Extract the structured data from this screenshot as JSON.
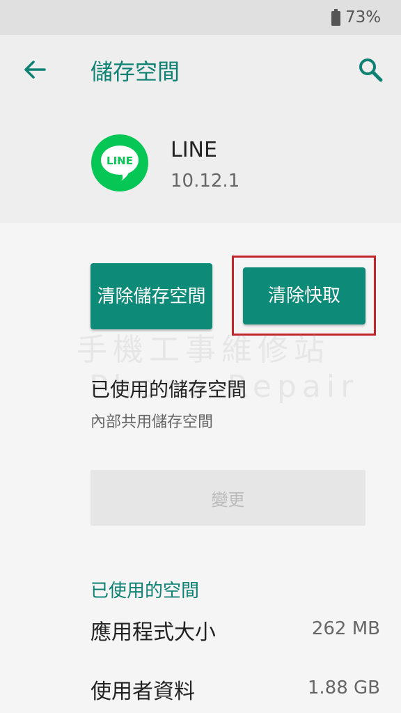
{
  "status_bar": {
    "battery_percent": "73%",
    "battery_icon": "battery-icon"
  },
  "header": {
    "title": "儲存空間",
    "back_icon": "arrow-back-icon",
    "search_icon": "search-icon"
  },
  "app": {
    "name": "LINE",
    "version": "10.12.1",
    "icon_label": "LINE"
  },
  "buttons": {
    "clear_storage": "清除儲存空間",
    "clear_cache": "清除快取"
  },
  "watermark": {
    "line1": "手機工事維修站",
    "line2": "Phone Repair"
  },
  "storage_used": {
    "title": "已使用的儲存空間",
    "subtitle": "內部共用儲存空間",
    "change_label": "變更"
  },
  "space_used": {
    "section_label": "已使用的空間",
    "rows": [
      {
        "label": "應用程式大小",
        "value": "262 MB"
      },
      {
        "label": "使用者資料",
        "value": "1.88 GB"
      }
    ]
  },
  "colors": {
    "accent": "#0e8a78",
    "highlight": "#c0262c",
    "line_green": "#06c755"
  }
}
